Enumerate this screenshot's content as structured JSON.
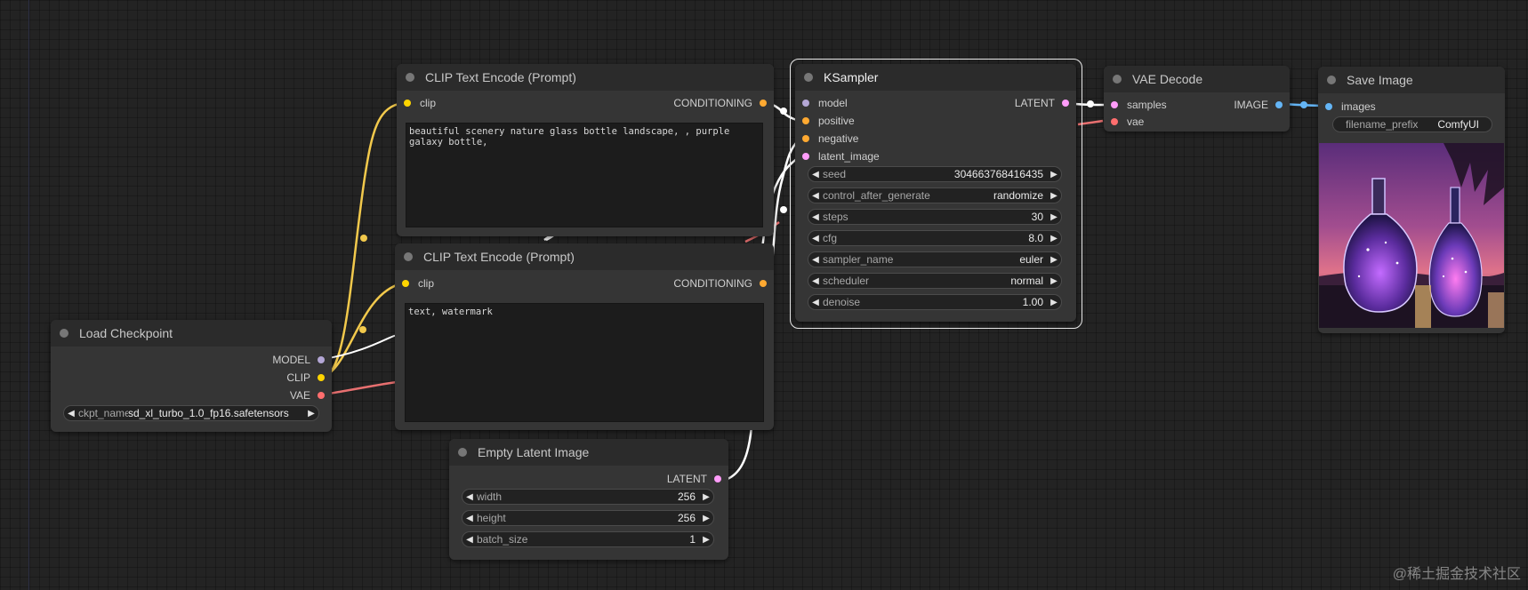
{
  "nodes": {
    "clip_pos": {
      "title": "CLIP Text Encode (Prompt)",
      "input_clip": "clip",
      "output": "CONDITIONING",
      "text": "beautiful scenery nature glass bottle landscape, , purple galaxy bottle,"
    },
    "clip_neg": {
      "title": "CLIP Text Encode (Prompt)",
      "input_clip": "clip",
      "output": "CONDITIONING",
      "text": "text, watermark"
    },
    "checkpoint": {
      "title": "Load Checkpoint",
      "outputs": [
        "MODEL",
        "CLIP",
        "VAE"
      ],
      "ckpt_label": "ckpt_name",
      "ckpt_value": "sd_xl_turbo_1.0_fp16.safetensors"
    },
    "latent": {
      "title": "Empty Latent Image",
      "output": "LATENT",
      "widgets": [
        {
          "label": "width",
          "value": "256"
        },
        {
          "label": "height",
          "value": "256"
        },
        {
          "label": "batch_size",
          "value": "1"
        }
      ]
    },
    "ksampler": {
      "title": "KSampler",
      "inputs": [
        "model",
        "positive",
        "negative",
        "latent_image"
      ],
      "output": "LATENT",
      "widgets": [
        {
          "label": "seed",
          "value": "304663768416435"
        },
        {
          "label": "control_after_generate",
          "value": "randomize"
        },
        {
          "label": "steps",
          "value": "30"
        },
        {
          "label": "cfg",
          "value": "8.0"
        },
        {
          "label": "sampler_name",
          "value": "euler"
        },
        {
          "label": "scheduler",
          "value": "normal"
        },
        {
          "label": "denoise",
          "value": "1.00"
        }
      ]
    },
    "vae_decode": {
      "title": "VAE Decode",
      "inputs": [
        "samples",
        "vae"
      ],
      "output": "IMAGE"
    },
    "save_image": {
      "title": "Save Image",
      "input": "images",
      "prefix_label": "filename_prefix",
      "prefix_value": "ComfyUI"
    }
  },
  "colors": {
    "model": "#b4a7d6",
    "clip": "#ffd500",
    "vae": "#ff6e6e",
    "conditioning": "#ffa931",
    "latent": "#ff9cf9",
    "image": "#64b5f6"
  },
  "watermark": "@稀土掘金技术社区"
}
